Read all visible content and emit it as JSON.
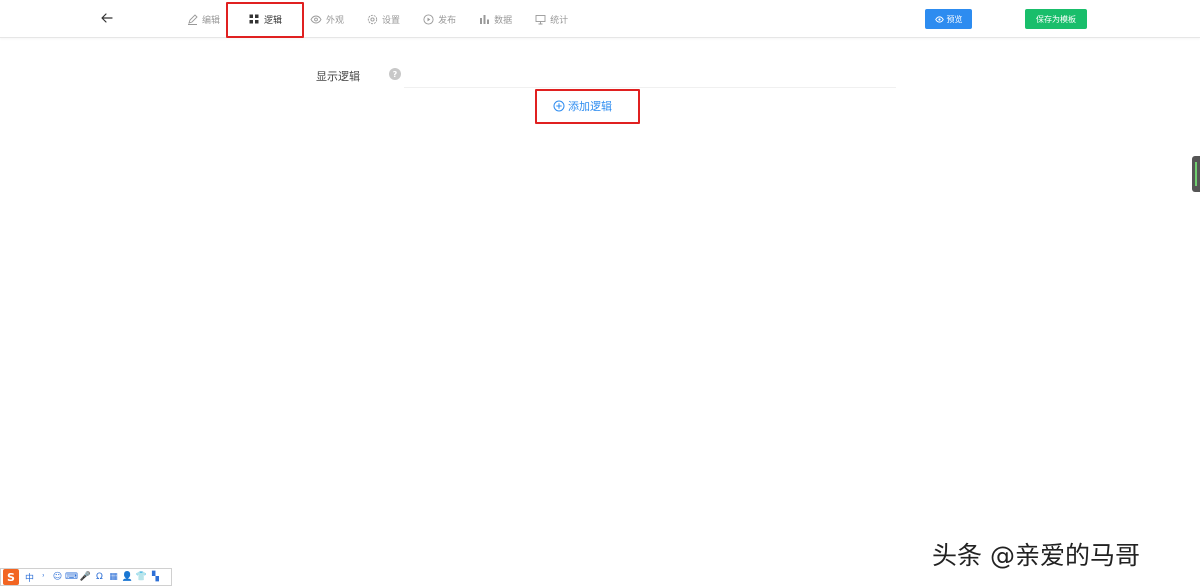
{
  "nav": {
    "items": [
      {
        "label": "编辑",
        "icon": "pencil-icon"
      },
      {
        "label": "逻辑",
        "icon": "grid-icon"
      },
      {
        "label": "外观",
        "icon": "eye-icon"
      },
      {
        "label": "设置",
        "icon": "gear-icon"
      },
      {
        "label": "发布",
        "icon": "play-icon"
      },
      {
        "label": "数据",
        "icon": "bar-chart-icon"
      },
      {
        "label": "统计",
        "icon": "presentation-icon"
      }
    ],
    "active_index": 1
  },
  "toolbar": {
    "preview_label": "预览",
    "save_template_label": "保存为模板"
  },
  "logic": {
    "section_label": "显示逻辑",
    "help_mark": "?",
    "add_label": "添加逻辑"
  },
  "ime": {
    "logo": "S",
    "items": [
      "中",
      "˒",
      "☺",
      "⌨",
      "🎤",
      "Ω",
      "▦",
      "👤",
      "👕",
      "▚"
    ]
  },
  "watermark": {
    "text": "头条 @亲爱的马哥"
  },
  "colors": {
    "primary_blue": "#2d8cf0",
    "save_green": "#19be6b",
    "highlight_red": "#e02020"
  }
}
